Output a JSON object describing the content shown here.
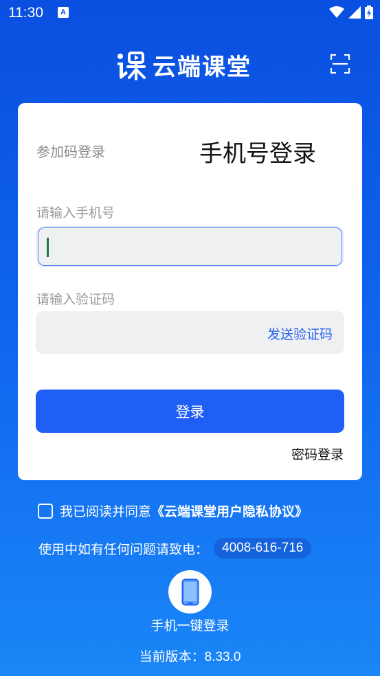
{
  "status_bar": {
    "time": "11:30",
    "notification_icon_letter": "A",
    "icons": [
      "wifi-icon",
      "signal-icon",
      "battery-icon"
    ]
  },
  "header": {
    "app_name": "云端课堂",
    "logo_icon": "logo-icon",
    "scan_icon": "scan-icon"
  },
  "login_card": {
    "tab_code_login": "参加码登录",
    "tab_phone_login": "手机号登录",
    "phone_label": "请输入手机号",
    "phone_value": "",
    "code_label": "请输入验证码",
    "code_value": "",
    "send_code": "发送验证码",
    "login_button": "登录",
    "password_login": "密码登录"
  },
  "agreement": {
    "checked": false,
    "text": "我已阅读并同意",
    "link": "《云端课堂用户隐私协议》"
  },
  "support": {
    "text": "使用中如有任何问题请致电：",
    "phone": "4008-616-716"
  },
  "one_click": {
    "label": "手机一键登录",
    "icon": "phone-icon"
  },
  "version": {
    "label": "当前版本：",
    "number": "8.33.0"
  },
  "colors": {
    "background_top": "#0a4fe0",
    "background_bottom": "#1a86f7",
    "primary": "#1f5ff6",
    "link": "#2a63f0"
  }
}
